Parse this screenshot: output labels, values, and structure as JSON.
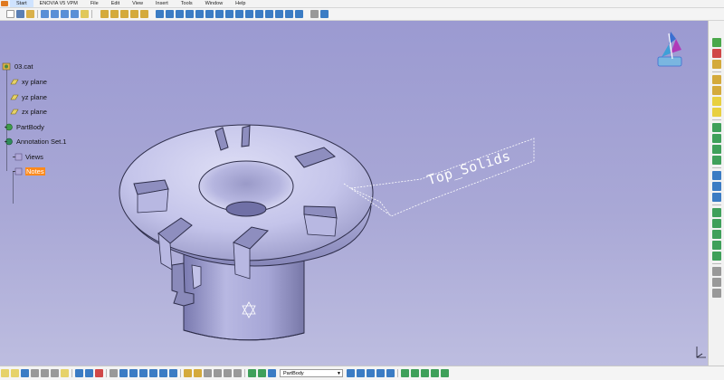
{
  "window": {
    "menus": [
      "Start",
      "ENOVIA V5 VPM",
      "File",
      "Edit",
      "View",
      "Insert",
      "Tools",
      "Window",
      "Help"
    ]
  },
  "spec_tree": {
    "root": "03.cat",
    "items": [
      {
        "label": "xy plane",
        "icon": "plane-icon"
      },
      {
        "label": "yz plane",
        "icon": "plane-icon"
      },
      {
        "label": "zx plane",
        "icon": "plane-icon"
      },
      {
        "label": "PartBody",
        "icon": "part-body-icon"
      },
      {
        "label": "Annotation Set.1",
        "icon": "annotation-set-icon"
      },
      {
        "label": "Views",
        "icon": "views-icon"
      },
      {
        "label": "Notes",
        "icon": "notes-icon"
      }
    ]
  },
  "annotation": {
    "text": "Top_Solids"
  },
  "bottom_toolbar": {
    "current_body": "PartBody"
  },
  "colors": {
    "viewport_top": "#9b9ad1",
    "viewport_bottom": "#bdbde0",
    "part_surface": "#c8c8ea",
    "part_shadow": "#9090c0",
    "selected_highlight": "#ff8a1c"
  }
}
